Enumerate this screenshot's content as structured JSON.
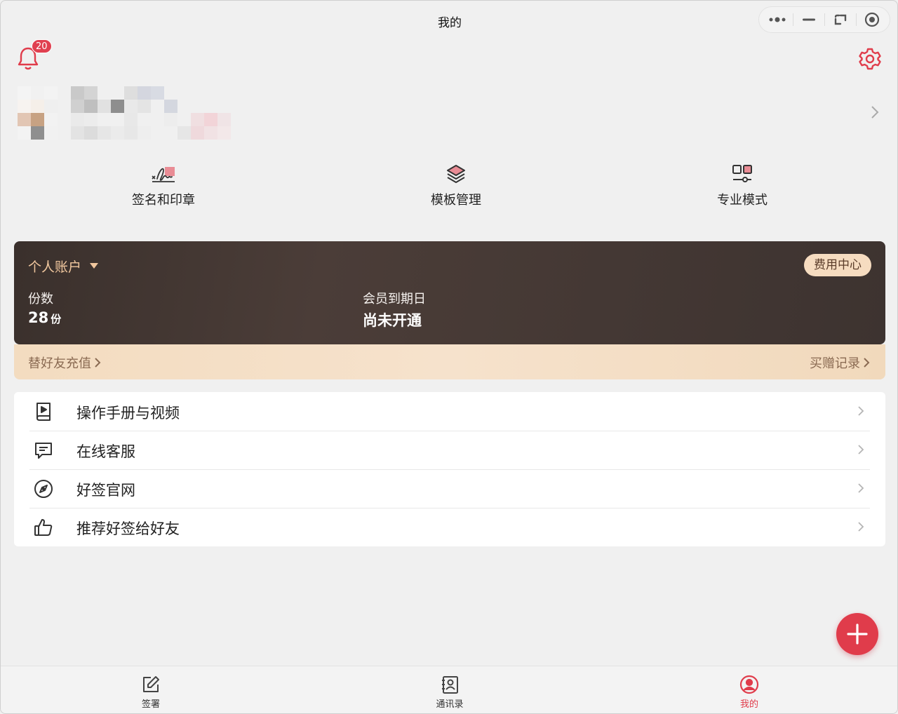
{
  "window": {
    "title": "我的"
  },
  "notifications": {
    "badge_count": "20"
  },
  "quick_actions": [
    {
      "label": "签名和印章",
      "icon": "signature-icon"
    },
    {
      "label": "模板管理",
      "icon": "layers-icon"
    },
    {
      "label": "专业模式",
      "icon": "pro-mode-icon"
    }
  ],
  "account": {
    "type_label": "个人账户",
    "fee_center_label": "费用中心",
    "copies_label": "份数",
    "copies_value": "28",
    "copies_unit": "份",
    "membership_label": "会员到期日",
    "membership_value": "尚未开通",
    "recharge_friend_label": "替好友充值",
    "purchase_records_label": "买赠记录"
  },
  "menu": [
    {
      "label": "操作手册与视频",
      "icon": "manual-video-icon"
    },
    {
      "label": "在线客服",
      "icon": "chat-icon"
    },
    {
      "label": "好签官网",
      "icon": "compass-icon"
    },
    {
      "label": "推荐好签给好友",
      "icon": "thumbs-up-icon"
    }
  ],
  "tabs": [
    {
      "label": "签署",
      "icon": "edit-icon",
      "active": false
    },
    {
      "label": "通讯录",
      "icon": "contacts-icon",
      "active": false
    },
    {
      "label": "我的",
      "icon": "user-icon",
      "active": true
    }
  ],
  "colors": {
    "accent": "#e03c4b",
    "card_gold": "#f1c79e",
    "card_bg": "#3d3330"
  }
}
